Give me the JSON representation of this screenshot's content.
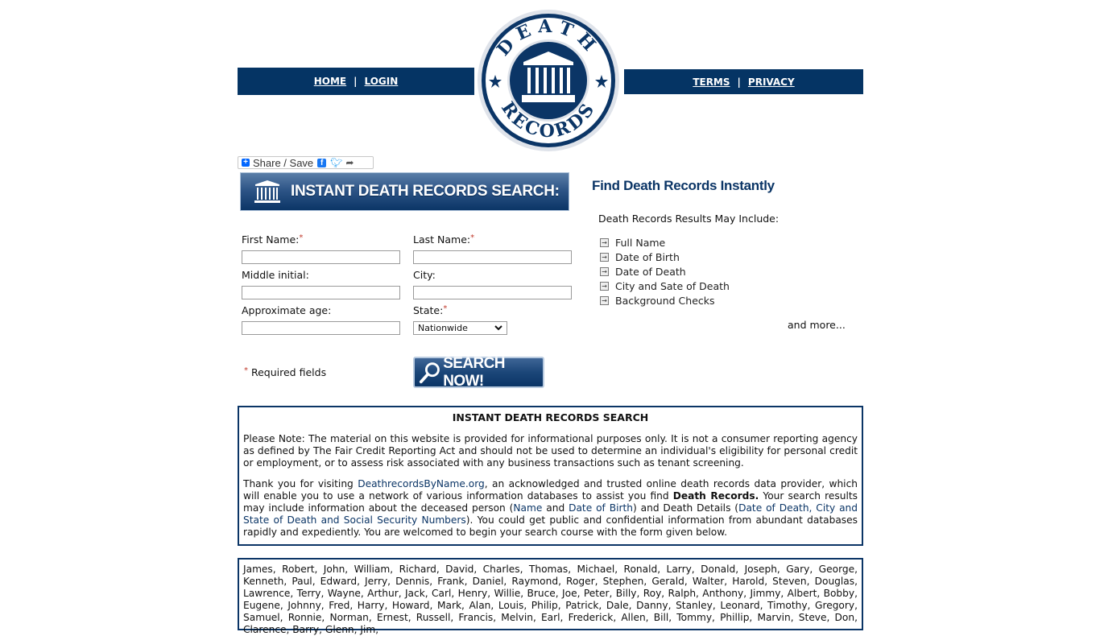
{
  "nav": {
    "left": [
      {
        "label": "HOME"
      },
      {
        "label": "LOGIN"
      }
    ],
    "right": [
      {
        "label": "TERMS"
      },
      {
        "label": "PRIVACY"
      }
    ],
    "separator": "|"
  },
  "logo": {
    "top_text": "DEATH",
    "bottom_text": "RECORDS"
  },
  "share": {
    "label": "Share / Save"
  },
  "search_panel": {
    "banner_title": "INSTANT DEATH RECORDS SEARCH:",
    "fields": {
      "first_name": {
        "label": "First Name:",
        "value": ""
      },
      "last_name": {
        "label": "Last Name:",
        "value": ""
      },
      "middle_initial": {
        "label": "Middle initial:",
        "value": ""
      },
      "city": {
        "label": "City:",
        "value": ""
      },
      "approx_age": {
        "label": "Approximate age:",
        "value": ""
      },
      "state": {
        "label": "State:",
        "selected": "Nationwide"
      }
    },
    "required_marker": "*",
    "required_note": "Required fields",
    "search_button": "SEARCH NOW!"
  },
  "right_column": {
    "title": "Find Death Records Instantly",
    "subtitle": "Death Records Results May Include:",
    "features": [
      "Full Name",
      "Date of Birth",
      "Date of Death",
      "City and Sate of Death",
      "Background Checks"
    ],
    "and_more": "and more..."
  },
  "info_box": {
    "heading": "INSTANT DEATH RECORDS SEARCH",
    "note": "Please Note: The material on this website is provided for informational purposes only. It is not a consumer reporting agency as defined by The Fair Credit Reporting Act and should not be used to determine an individual's eligibility for personal credit or employment, or to assess risk associated with any business transactions such as tenant screening.",
    "p2": {
      "t1": "Thank you for visiting ",
      "site": "DeathrecordsByName.org",
      "t2": ", an acknowledged and trusted online death records data provider, which will enable you to use a network of various information databases to assist you find ",
      "death_records": "Death Records.",
      "t3": " Your search results may include information about the deceased person (",
      "name": "Name",
      "and": " and ",
      "dob": "Date of Birth",
      "t4": ") and Death Details (",
      "details": "Date of Death, City and State of Death and Social Security Numbers",
      "t5": "). You could get public and confidential information from abundant databases rapidly and expediently. You are welcomed to begin your search course with the form given below."
    }
  },
  "names_box": {
    "text": "James, Robert, John, William, Richard, David, Charles, Thomas, Michael, Ronald, Larry, Donald, Joseph, Gary, George, Kenneth, Paul, Edward, Jerry, Dennis, Frank, Daniel, Raymond, Roger, Stephen, Gerald, Walter, Harold, Steven, Douglas, Lawrence, Terry, Wayne, Arthur, Jack, Carl, Henry, Willie, Bruce, Joe, Peter, Billy, Roy, Ralph, Anthony, Jimmy, Albert, Bobby, Eugene, Johnny, Fred, Harry, Howard, Mark, Alan, Louis, Philip, Patrick, Dale, Danny, Stanley, Leonard, Timothy, Gregory, Samuel, Ronnie, Norman, Ernest, Russell, Francis, Melvin, Earl, Frederick, Allen, Bill, Tommy, Phillip, Marvin, Steve, Don, Clarence, Barry, Glenn, Jim,"
  },
  "colors": {
    "brand_navy": "#053464",
    "required_red": "#c0392b",
    "link_navy": "#0b3566"
  }
}
